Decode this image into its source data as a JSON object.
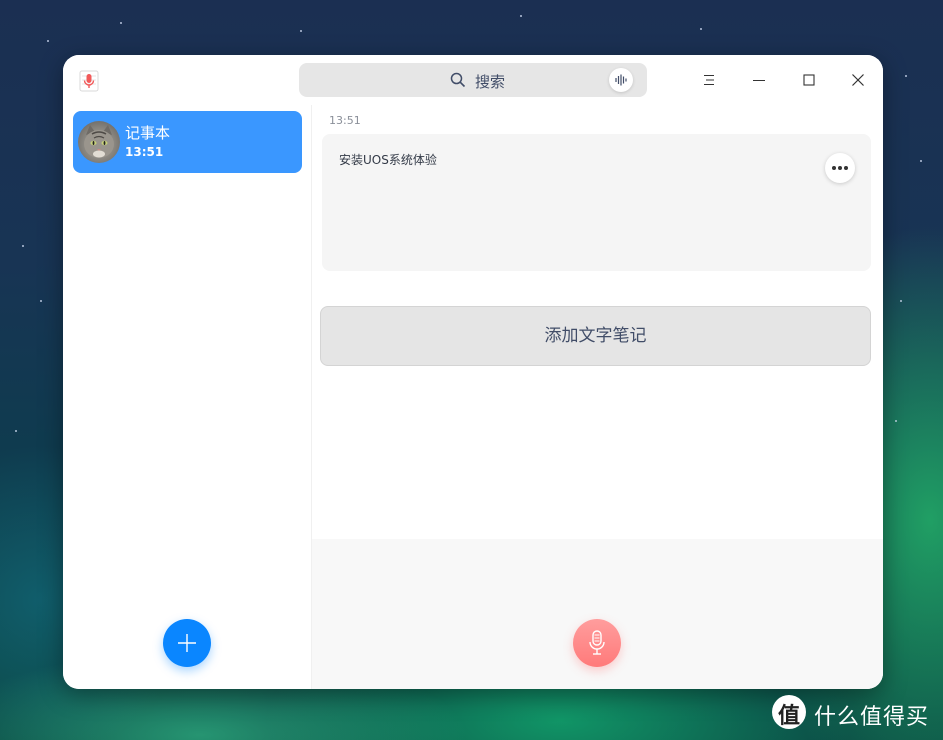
{
  "titlebar": {
    "search_placeholder": "搜索",
    "app_icon": "voice-notes-icon",
    "menu_icon": "hamburger-menu-icon",
    "minimize_icon": "minimize-icon",
    "maximize_icon": "maximize-icon",
    "close_icon": "close-icon"
  },
  "sidebar": {
    "notebooks": [
      {
        "name": "记事本",
        "time": "13:51",
        "selected": true
      }
    ],
    "add_button_icon": "plus-icon"
  },
  "main": {
    "notes": [
      {
        "time": "13:51",
        "text": "安装UOS系统体验"
      }
    ],
    "add_text_note_label": "添加文字笔记",
    "record_button_icon": "microphone-icon"
  },
  "watermark": {
    "logo_char": "值",
    "text": "什么值得买"
  },
  "colors": {
    "accent": "#0a86ff",
    "selected_item": "#3a97ff",
    "record": "#ff8a8a"
  }
}
